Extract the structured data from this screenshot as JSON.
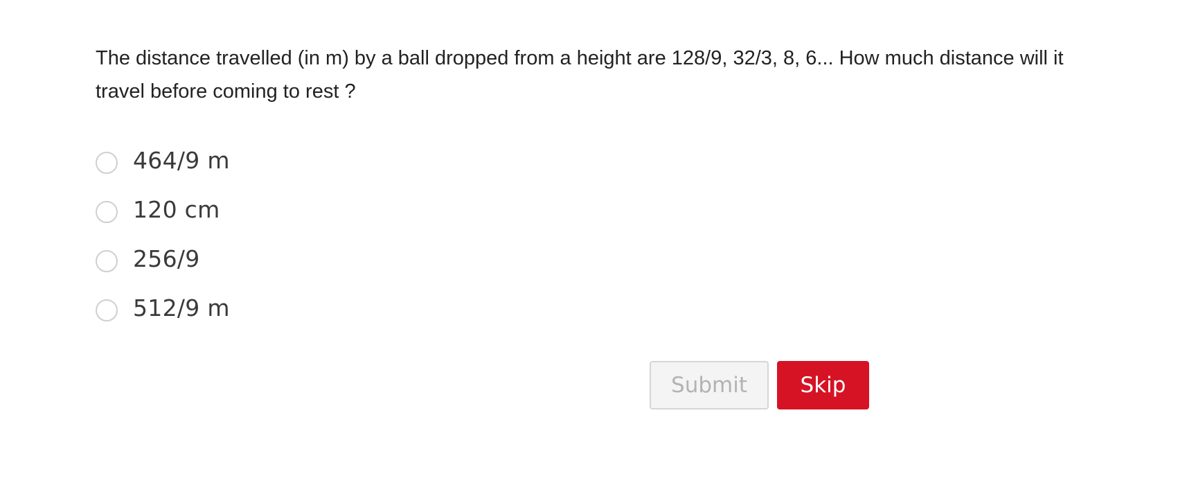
{
  "question": {
    "text": "The distance travelled (in m) by a ball dropped from a height are 128/9, 32/3, 8, 6... How much distance will it travel before coming to rest ?"
  },
  "options": [
    {
      "label": "464/9 m"
    },
    {
      "label": "120 cm"
    },
    {
      "label": "256/9"
    },
    {
      "label": "512/9 m"
    }
  ],
  "actions": {
    "submit_label": "Submit",
    "skip_label": "Skip"
  },
  "colors": {
    "skip_button": "#d51324",
    "submit_button_disabled_bg": "#f4f4f4",
    "submit_button_disabled_text": "#b3b3b3",
    "radio_border": "#cfcfcf"
  }
}
